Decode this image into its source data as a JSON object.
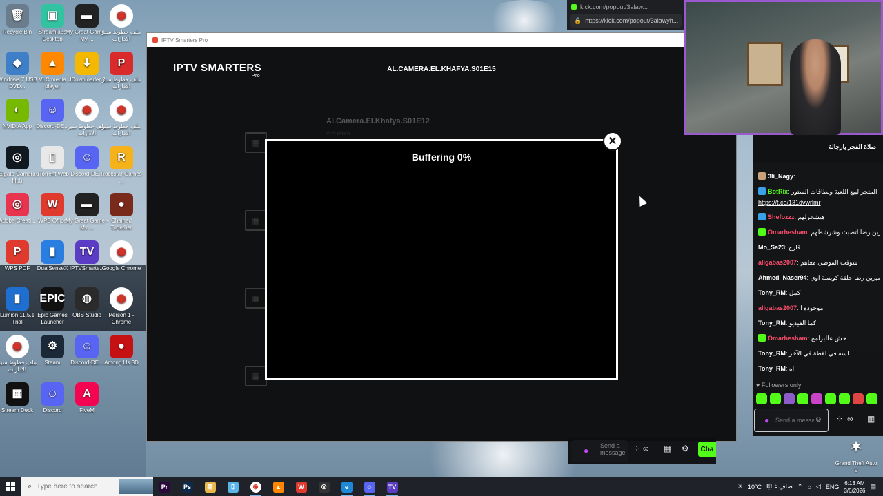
{
  "desktop": {
    "icons": [
      {
        "label": "Recycle Bin",
        "icon": "recycle-bin-icon",
        "color": "#6b7c8c",
        "glyph": "🗑"
      },
      {
        "label": "Streamlabs Desktop",
        "icon": "streamlabs-icon",
        "color": "#31c3a2",
        "glyph": "▣"
      },
      {
        "label": "My Great Game - My ...",
        "icon": "game-icon",
        "color": "#222",
        "glyph": "▬"
      },
      {
        "label": "ملف خطوط سير الادارات",
        "icon": "chrome-icon",
        "color": "#fff",
        "glyph": "◉"
      },
      {
        "label": "Windows 7 USB DVD...",
        "icon": "usb-dvd-icon",
        "color": "#3f7fc7",
        "glyph": "◆"
      },
      {
        "label": "VLC media player",
        "icon": "vlc-icon",
        "color": "#ff8800",
        "glyph": "▲"
      },
      {
        "label": "JDownloader 2",
        "icon": "jdownloader-icon",
        "color": "#f5b800",
        "glyph": "⬇"
      },
      {
        "label": "ملف خطوط سير الادارات",
        "icon": "pdf-icon",
        "color": "#d92b2b",
        "glyph": "P"
      },
      {
        "label": "NVIDIA App",
        "icon": "nvidia-icon",
        "color": "#76b900",
        "glyph": "◐"
      },
      {
        "label": "Discord-DE...",
        "icon": "discord-icon",
        "color": "#5865f2",
        "glyph": "☺"
      },
      {
        "label": "ملف خطوط سير الادارات",
        "icon": "chrome-icon",
        "color": "#fff",
        "glyph": "◉"
      },
      {
        "label": "ملف خطوط سير الادارات",
        "icon": "chrome-icon",
        "color": "#fff",
        "glyph": "◉"
      },
      {
        "label": "Elgato Camera Hub",
        "icon": "elgato-icon",
        "color": "#101820",
        "glyph": "◎"
      },
      {
        "label": "uTorrent Web",
        "icon": "file-icon",
        "color": "#e8e8e8",
        "glyph": "▯"
      },
      {
        "label": "Discord-DE...",
        "icon": "discord-icon",
        "color": "#5865f2",
        "glyph": "☺"
      },
      {
        "label": "Rockstar Games ...",
        "icon": "rockstar-icon",
        "color": "#f6b21a",
        "glyph": "R"
      },
      {
        "label": "Adobe Creati...",
        "icon": "adobe-cc-icon",
        "color": "#e8344e",
        "glyph": "◎"
      },
      {
        "label": "WPS Office",
        "icon": "wps-office-icon",
        "color": "#e03a2f",
        "glyph": "W"
      },
      {
        "label": "My Great Game - My ...",
        "icon": "game-icon",
        "color": "#222",
        "glyph": "▬"
      },
      {
        "label": "Chained Together",
        "icon": "chained-together-icon",
        "color": "#7a2a1a",
        "glyph": "●"
      },
      {
        "label": "WPS PDF",
        "icon": "wps-pdf-icon",
        "color": "#e03a2f",
        "glyph": "P"
      },
      {
        "label": "DualSenseX",
        "icon": "dualsensex-icon",
        "color": "#2a7de1",
        "glyph": "▮"
      },
      {
        "label": "IPTVSmarte...",
        "icon": "iptv-smarters-icon",
        "color": "#5b3cc4",
        "glyph": "TV"
      },
      {
        "label": "Google Chrome",
        "icon": "chrome-icon",
        "color": "#fff",
        "glyph": "◉"
      },
      {
        "label": "Lumion 11.5.1 Trial",
        "icon": "lumion-icon",
        "color": "#1f6fd1",
        "glyph": "▮"
      },
      {
        "label": "Epic Games Launcher",
        "icon": "epic-games-icon",
        "color": "#111",
        "glyph": "EPIC"
      },
      {
        "label": "OBS Studio",
        "icon": "obs-icon",
        "color": "#2b2b2b",
        "glyph": "◍"
      },
      {
        "label": "Person 1 - Chrome",
        "icon": "chrome-icon",
        "color": "#fff",
        "glyph": "◉"
      },
      {
        "label": "ملف خطوط سير الادارات",
        "icon": "chrome-icon",
        "color": "#fff",
        "glyph": "◉"
      },
      {
        "label": "Steam",
        "icon": "steam-icon",
        "color": "#1b2838",
        "glyph": "⚙"
      },
      {
        "label": "Discord-DE...",
        "icon": "discord-icon",
        "color": "#5865f2",
        "glyph": "☺"
      },
      {
        "label": "Among Us 3D",
        "icon": "among-us-icon",
        "color": "#c51111",
        "glyph": "●"
      },
      {
        "label": "Stream Deck",
        "icon": "stream-deck-icon",
        "color": "#111",
        "glyph": "▦"
      },
      {
        "label": "Discord",
        "icon": "discord-icon",
        "color": "#5865f2",
        "glyph": "☺"
      },
      {
        "label": "FiveM",
        "icon": "fivem-icon",
        "color": "#f40552",
        "glyph": "A"
      }
    ],
    "gta": {
      "label": "Grand Theft Auto V"
    }
  },
  "iptv": {
    "window_title": "IPTV Smarters Pro",
    "logo": "IPTV SMARTERS",
    "logo_sub": "Pro",
    "episode_title": "AL.CAMERA.EL.KHAFYA.S01E15",
    "background_episode": "Al.Camera.El.Khafya.S01E12",
    "rating": "☆☆☆☆☆",
    "player": {
      "status": "Buffering 0%"
    }
  },
  "kick": {
    "tab_title": "kick.com/popout/3alaw...",
    "url": "https://kick.com/popout/3alawyh..."
  },
  "chat": {
    "pinned": "صلاة الفجر يارجالة",
    "messages": [
      {
        "user": "3li_Nagy",
        "text": "",
        "color": "#ffffff",
        "badge": "#c9a37b"
      },
      {
        "user": "BotRix",
        "text": "المتجر لبيع اللعبة وبطاقات الستور",
        "color": "#53fc18",
        "badge": "#3aa0e8"
      },
      {
        "user": "",
        "text": "https://t.co/131dvwrlmr",
        "color": "#ffffff",
        "badge": "",
        "link": true
      },
      {
        "user": "Shefozzz",
        "text": "هيشخرلهم",
        "color": "#ff4d6d",
        "badge": "#3aa0e8"
      },
      {
        "user": "Omarhesham",
        "text": "شيرين رضا اتصبت وشرشطهم",
        "color": "#ff4d6d",
        "badge": "#53fc18"
      },
      {
        "user": "Mo_Sa23",
        "text": "قارح",
        "color": "#ffffff",
        "badge": ""
      },
      {
        "user": "aligabas2007",
        "text": "شوفت الموضي معاهم",
        "color": "#ff4d6d",
        "badge": ""
      },
      {
        "user": "Ahmed_Naser94",
        "text": "شيرين رضا حلقة كويسة اوي",
        "color": "#ffffff",
        "badge": ""
      },
      {
        "user": "Tony_RM",
        "text": "كمل",
        "color": "#ffffff",
        "badge": ""
      },
      {
        "user": "aligabas2007",
        "text": "موجودة ا",
        "color": "#ff4d6d",
        "badge": ""
      },
      {
        "user": "Tony_RM",
        "text": "كما الفيديو",
        "color": "#ffffff",
        "badge": ""
      },
      {
        "user": "Omarhesham",
        "text": "خش عالبرامج",
        "color": "#ff4d6d",
        "badge": "#53fc18"
      },
      {
        "user": "Tony_RM",
        "text": "لسه في لقطة في الآخر",
        "color": "#ffffff",
        "badge": ""
      },
      {
        "user": "Tony_RM",
        "text": "اه",
        "color": "#ffffff",
        "badge": ""
      }
    ],
    "followers_only": "Followers only",
    "input_placeholder": "Send a message",
    "chat_button": "Cha"
  },
  "taskbar": {
    "search_placeholder": "Type here to search",
    "apps": [
      "premiere-icon",
      "photoshop-icon",
      "file-explorer-icon",
      "notepad-icon",
      "chrome-icon",
      "vlc-icon",
      "wps-icon",
      "openai-icon",
      "edge-icon",
      "discord-icon",
      "iptv-icon"
    ],
    "weather": "10°C",
    "weather_desc": "صافٍ غالبًا",
    "language": "ENG",
    "time": "6:13 AM",
    "date": "3/6/2026"
  }
}
